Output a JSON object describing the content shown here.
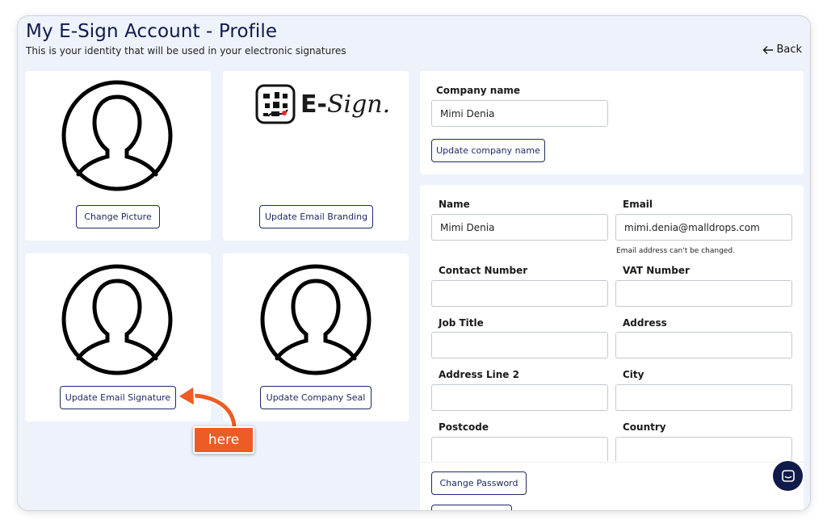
{
  "page": {
    "title": "My E-Sign Account - Profile",
    "subtitle": "This is your identity that will be used in your electronic signatures",
    "back_label": "Back"
  },
  "cards": {
    "picture": {
      "button": "Change Picture"
    },
    "branding": {
      "button": "Update Email Branding",
      "logo_text_e": "E-",
      "logo_text_sign": "Sign."
    },
    "signature": {
      "button": "Update Email Signature"
    },
    "seal": {
      "button": "Update Company Seal"
    }
  },
  "company": {
    "label": "Company name",
    "value": "Mimi Denia",
    "button": "Update company name"
  },
  "profile": {
    "name": {
      "label": "Name",
      "value": "Mimi Denia"
    },
    "email": {
      "label": "Email",
      "value": "mimi.denia@malldrops.com",
      "note": "Email address can't be changed."
    },
    "contact": {
      "label": "Contact Number",
      "value": ""
    },
    "vat": {
      "label": "VAT Number",
      "value": ""
    },
    "job": {
      "label": "Job Title",
      "value": ""
    },
    "address": {
      "label": "Address",
      "value": ""
    },
    "address2": {
      "label": "Address Line 2",
      "value": ""
    },
    "city": {
      "label": "City",
      "value": ""
    },
    "postcode": {
      "label": "Postcode",
      "value": ""
    },
    "country": {
      "label": "Country",
      "value": ""
    },
    "change_password": "Change Password"
  },
  "annotation": {
    "label": "here"
  },
  "colors": {
    "accent": "#1d2a63",
    "background": "#eef3fb",
    "callout": "#ee5b25",
    "chat": "#111b4a"
  },
  "icons": {
    "back": "arrow-left-icon",
    "avatar": "user-avatar-icon",
    "chat": "chat-bubble-icon"
  }
}
